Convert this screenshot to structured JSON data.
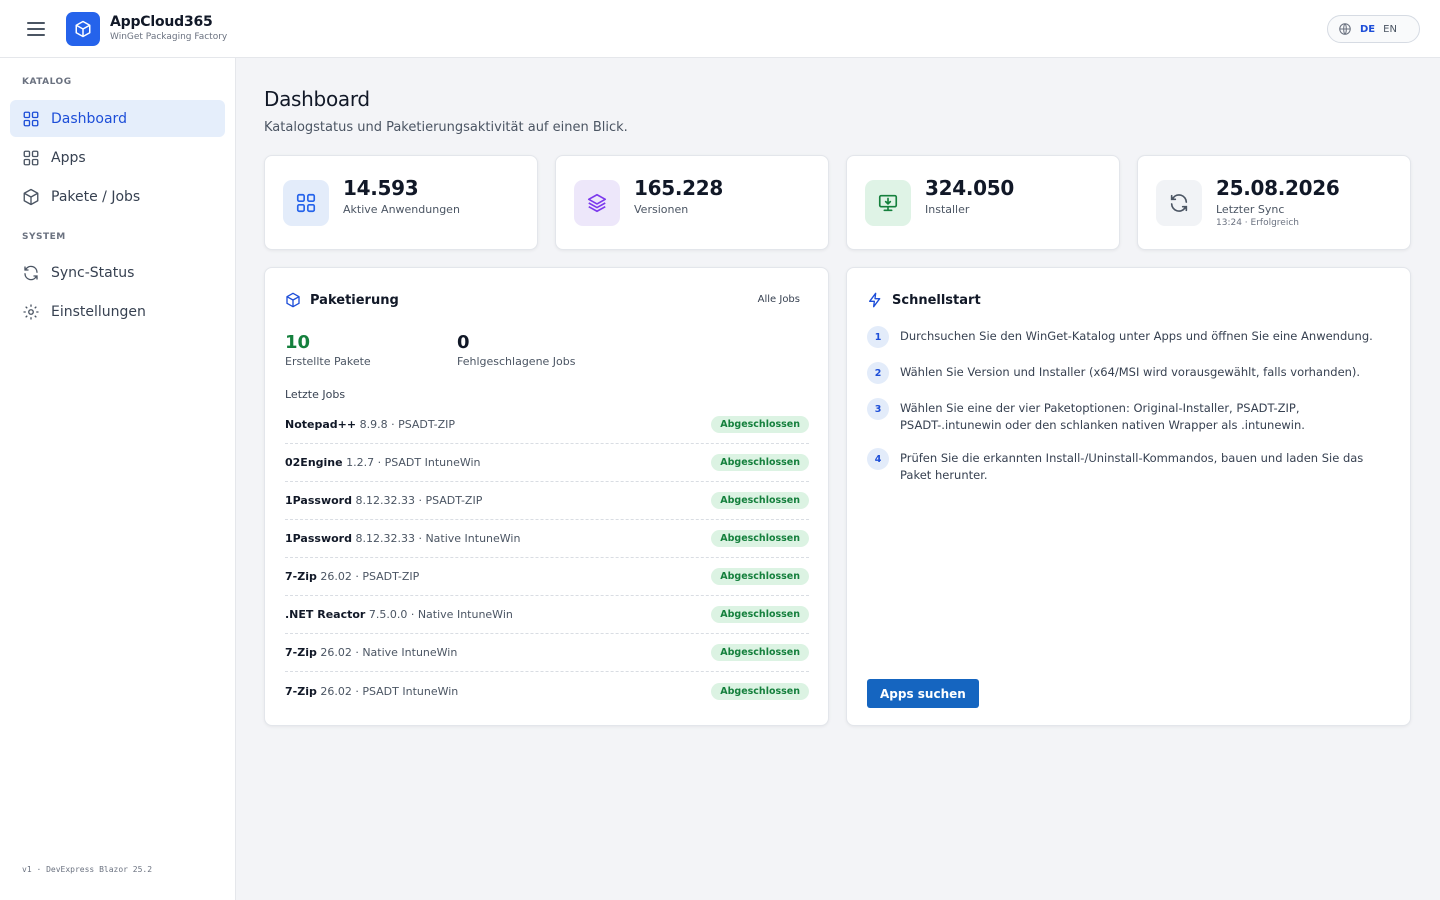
{
  "app": {
    "name": "AppCloud365",
    "subtitle": "WinGet Packaging Factory",
    "icons": {
      "menu": "hamburger-menu-icon",
      "logo": "package-cube-icon",
      "language": "globe-icon"
    },
    "languages": [
      "DE",
      "EN"
    ],
    "active_language": "DE"
  },
  "sidebar": {
    "sections": [
      {
        "title": "KATALOG",
        "items": [
          {
            "label": "Dashboard",
            "icon": "grid-icon",
            "active": true
          },
          {
            "label": "Apps",
            "icon": "apps-grid-icon",
            "active": false
          },
          {
            "label": "Pakete / Jobs",
            "icon": "package-icon",
            "active": false
          }
        ]
      },
      {
        "title": "SYSTEM",
        "items": [
          {
            "label": "Sync-Status",
            "icon": "refresh-icon",
            "active": false
          },
          {
            "label": "Einstellungen",
            "icon": "gear-icon",
            "active": false
          }
        ]
      }
    ],
    "footer": "v1 · DevExpress Blazor 25.2"
  },
  "page": {
    "title": "Dashboard",
    "subtitle": "Katalogstatus und Paketierungsaktivität auf einen Blick."
  },
  "stats": [
    {
      "value": "14.593",
      "label": "Aktive Anwendungen",
      "extra": "",
      "icon": "apps-grid-icon",
      "bg": "#e3ecfa",
      "color": "#2563eb"
    },
    {
      "value": "165.228",
      "label": "Versionen",
      "extra": "",
      "icon": "layers-icon",
      "bg": "#ede7fa",
      "color": "#7c3aed"
    },
    {
      "value": "324.050",
      "label": "Installer",
      "extra": "",
      "icon": "monitor-download-icon",
      "bg": "#dff3e6",
      "color": "#15803d"
    },
    {
      "value": "25.08.2026",
      "label": "Letzter Sync",
      "extra": "13:24 · Erfolgreich",
      "icon": "refresh-icon",
      "bg": "#f1f3f6",
      "color": "#4b5563"
    }
  ],
  "packaging": {
    "title": "Paketierung",
    "all_jobs_label": "Alle Jobs",
    "created_count": "10",
    "created_label": "Erstellte Pakete",
    "failed_count": "0",
    "failed_label": "Fehlgeschlagene Jobs",
    "recent_label": "Letzte Jobs",
    "jobs": [
      {
        "name": "Notepad++",
        "detail": "8.9.8 · PSADT-ZIP",
        "status": "Abgeschlossen"
      },
      {
        "name": "02Engine",
        "detail": "1.2.7 · PSADT IntuneWin",
        "status": "Abgeschlossen"
      },
      {
        "name": "1Password",
        "detail": "8.12.32.33 · PSADT-ZIP",
        "status": "Abgeschlossen"
      },
      {
        "name": "1Password",
        "detail": "8.12.32.33 · Native IntuneWin",
        "status": "Abgeschlossen"
      },
      {
        "name": "7-Zip",
        "detail": "26.02 · PSADT-ZIP",
        "status": "Abgeschlossen"
      },
      {
        "name": ".NET Reactor",
        "detail": "7.5.0.0 · Native IntuneWin",
        "status": "Abgeschlossen"
      },
      {
        "name": "7-Zip",
        "detail": "26.02 · Native IntuneWin",
        "status": "Abgeschlossen"
      },
      {
        "name": "7-Zip",
        "detail": "26.02 · PSADT IntuneWin",
        "status": "Abgeschlossen"
      }
    ]
  },
  "quickstart": {
    "title": "Schnellstart",
    "steps": [
      {
        "num": "1",
        "text": "Durchsuchen Sie den WinGet-Katalog unter Apps und öffnen Sie eine Anwendung."
      },
      {
        "num": "2",
        "text": "Wählen Sie Version und Installer (x64/MSI wird vorausgewählt, falls vorhanden)."
      },
      {
        "num": "3",
        "text": "Wählen Sie eine der vier Paketoptionen: Original-Installer, PSADT-ZIP, PSADT-.intunewin oder den schlanken nativen Wrapper als .intunewin."
      },
      {
        "num": "4",
        "text": "Prüfen Sie die erkannten Install-/Uninstall-Kommandos, bauen und laden Sie das Paket herunter."
      }
    ],
    "button_label": "Apps suchen"
  },
  "colors": {
    "accent": "#1d4ed8",
    "primary_button": "#1565c0",
    "success": "#15803d",
    "badge_bg": "#dcf3e3"
  }
}
